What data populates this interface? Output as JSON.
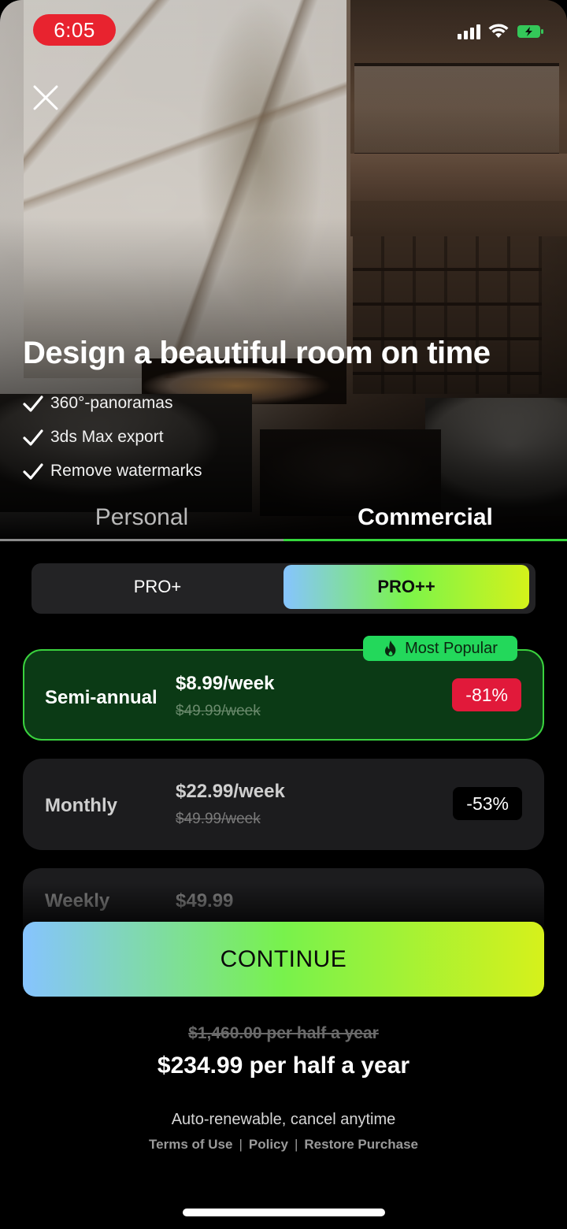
{
  "status_bar": {
    "time": "6:05"
  },
  "hero": {
    "headline": "Design a beautiful room on time"
  },
  "features": [
    {
      "label": "360°-panoramas"
    },
    {
      "label": "3ds Max export"
    },
    {
      "label": "Remove watermarks"
    }
  ],
  "segments": {
    "personal": "Personal",
    "commercial": "Commercial",
    "active": "Commercial"
  },
  "tiers": {
    "option_a": "PRO+",
    "option_b": "PRO++",
    "active": "PRO++"
  },
  "popular_badge": "Most Popular",
  "plans": [
    {
      "name": "Semi-annual",
      "price": "$8.99/week",
      "old_price": "$49.99/week",
      "discount": "-81%",
      "selected": true
    },
    {
      "name": "Monthly",
      "price": "$22.99/week",
      "old_price": "$49.99/week",
      "discount": "-53%",
      "selected": false
    },
    {
      "name": "Weekly",
      "price": "$49.99",
      "selected": false
    }
  ],
  "continue_label": "CONTINUE",
  "summary": {
    "old_total": "$1,460.00 per half a year",
    "total": "$234.99 per half a year"
  },
  "footer": {
    "renew_note": "Auto-renewable, cancel anytime",
    "terms": "Terms of Use",
    "policy": "Policy",
    "restore": "Restore Purchase",
    "separator": "|"
  },
  "colors": {
    "selected_border": "#3ad23e",
    "discount_red": "#e1193a",
    "popular_green": "#23d85b",
    "gradient_start": "#86c4ff",
    "gradient_mid": "#78f24c",
    "gradient_end": "#d6f11b",
    "status_time_bg": "#e8232f"
  },
  "icons": [
    "close-icon",
    "check-icon",
    "fire-icon",
    "signal-icon",
    "wifi-icon",
    "battery-charging-icon"
  ]
}
